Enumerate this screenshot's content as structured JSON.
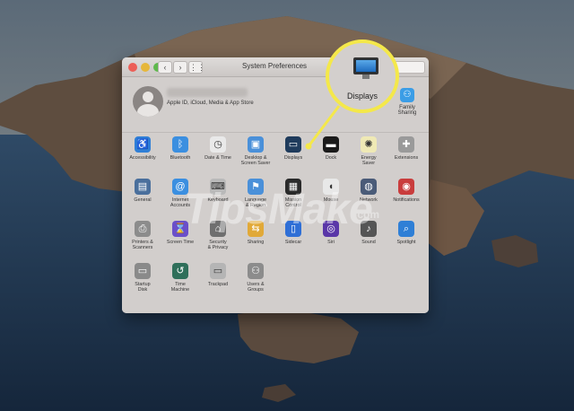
{
  "window": {
    "title": "System Preferences",
    "nav_back": "‹",
    "nav_forward": "›",
    "grid": "⋮⋮"
  },
  "account": {
    "subtitle": "Apple ID, iCloud, Media & App Store",
    "family_label": "Family\nSharing",
    "family_icon": "family-icon"
  },
  "callout": {
    "label": "Displays",
    "color": "#f4e84a"
  },
  "panes": [
    {
      "label": "Accessibility",
      "icon": "accessibility-icon",
      "color": "#2f7fd6"
    },
    {
      "label": "Bluetooth",
      "icon": "bluetooth-icon",
      "color": "#3b8fe0"
    },
    {
      "label": "Date & Time",
      "icon": "clock-icon",
      "color": "#e9e9e9"
    },
    {
      "label": "Desktop &\nScreen Saver",
      "icon": "desktop-icon",
      "color": "#4a90d9"
    },
    {
      "label": "Displays",
      "icon": "display-icon",
      "color": "#1f3b5c"
    },
    {
      "label": "Dock",
      "icon": "dock-icon",
      "color": "#1a1a1a"
    },
    {
      "label": "Energy\nSaver",
      "icon": "lightbulb-icon",
      "color": "#efe9b5"
    },
    {
      "label": "Extensions",
      "icon": "puzzle-icon",
      "color": "#9a9a9a"
    },
    {
      "label": "General",
      "icon": "general-icon",
      "color": "#4a6f9c"
    },
    {
      "label": "Internet\nAccounts",
      "icon": "at-icon",
      "color": "#3b8fe0"
    },
    {
      "label": "Keyboard",
      "icon": "keyboard-icon",
      "color": "#b9b9b9"
    },
    {
      "label": "Language\n& Region",
      "icon": "flag-icon",
      "color": "#4a90d9"
    },
    {
      "label": "Mission\nControl",
      "icon": "mission-control-icon",
      "color": "#2a2a2a"
    },
    {
      "label": "Mouse",
      "icon": "mouse-icon",
      "color": "#e8e8e8"
    },
    {
      "label": "Network",
      "icon": "globe-icon",
      "color": "#4a5b78"
    },
    {
      "label": "Notifications",
      "icon": "notifications-icon",
      "color": "#c93d3d"
    },
    {
      "label": "Printers &\nScanners",
      "icon": "printer-icon",
      "color": "#8c8c8c"
    },
    {
      "label": "Screen Time",
      "icon": "hourglass-icon",
      "color": "#6a4fc9"
    },
    {
      "label": "Security\n& Privacy",
      "icon": "house-lock-icon",
      "color": "#6f6f6f"
    },
    {
      "label": "Sharing",
      "icon": "sharing-icon",
      "color": "#e1a938"
    },
    {
      "label": "Sidecar",
      "icon": "sidecar-icon",
      "color": "#2f6fd6"
    },
    {
      "label": "Siri",
      "icon": "siri-icon",
      "color": "#5a37a8"
    },
    {
      "label": "Sound",
      "icon": "speaker-icon",
      "color": "#555555"
    },
    {
      "label": "Spotlight",
      "icon": "spotlight-icon",
      "color": "#2f7fd6"
    },
    {
      "label": "Startup\nDisk",
      "icon": "disk-icon",
      "color": "#8a8a8a"
    },
    {
      "label": "Time\nMachine",
      "icon": "time-machine-icon",
      "color": "#2f6f5a"
    },
    {
      "label": "Trackpad",
      "icon": "trackpad-icon",
      "color": "#b5b5b5"
    },
    {
      "label": "Users &\nGroups",
      "icon": "users-icon",
      "color": "#8c8c8c"
    }
  ],
  "watermark": {
    "text": "TipsMake",
    "suffix": ".com"
  }
}
